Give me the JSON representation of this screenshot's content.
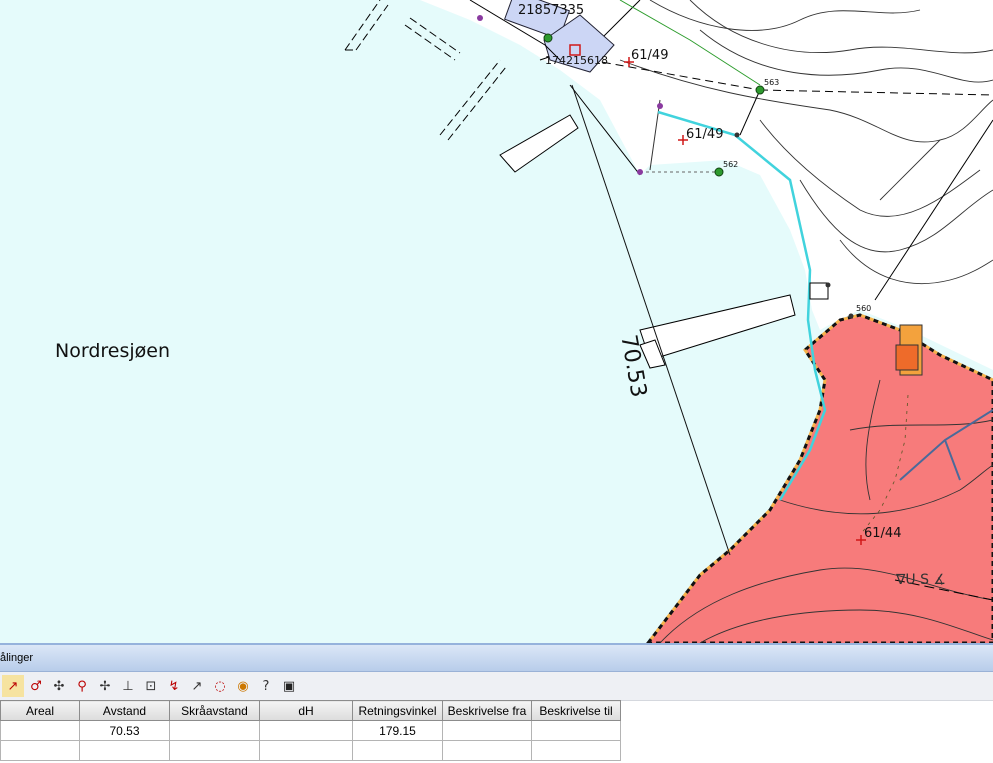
{
  "map": {
    "lake_name": "Nordresjøen",
    "measurement_line_label": "70.53",
    "labels": {
      "parcel_top": "21857335",
      "parcel_building": "174215618",
      "parcel_a": "61/49",
      "parcel_b": "61/49",
      "parcel_c": "61/44",
      "point_563": "563",
      "point_562": "562",
      "point_560": "560",
      "zone_code": "∇U S ∡"
    },
    "colors": {
      "water": "#e5fbfb",
      "zone_fill": "#f77b7b",
      "building_fill": "#ccd6f5",
      "shoreline": "#41d3dd",
      "zone_border": "#111111",
      "zone_border_dash": "#f5b24a"
    }
  },
  "panel": {
    "title": "ålinger",
    "toolbar_icons": [
      "measure-line-icon",
      "measure-angle-icon",
      "point-icon",
      "zoom-in-icon",
      "point-snap-icon",
      "perpendicular-icon",
      "area-icon",
      "curve-icon",
      "arrow-icon",
      "circle-icon",
      "target-icon",
      "help-icon",
      "save-icon"
    ],
    "table": {
      "columns": [
        "Areal",
        "Avstand",
        "Skråavstand",
        "dH",
        "Retningsvinkel",
        "Beskrivelse fra",
        "Beskrivelse til"
      ],
      "rows": [
        [
          "",
          "70.53",
          "",
          "",
          "179.15",
          "",
          ""
        ],
        [
          "",
          "",
          "",
          "",
          "",
          "",
          ""
        ]
      ]
    }
  }
}
